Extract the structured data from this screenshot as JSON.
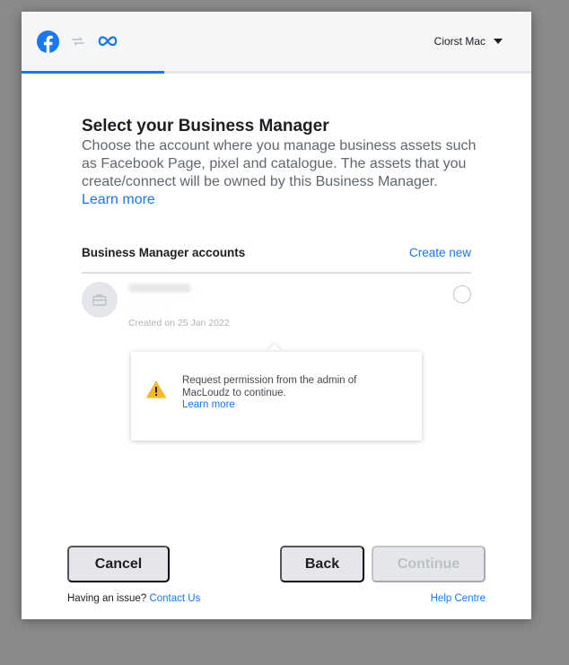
{
  "header": {
    "user_name": "Ciorst Mac",
    "progress_percent": 28
  },
  "main": {
    "title": "Select your Business Manager",
    "description": "Choose the account where you manage business assets such as Facebook Page, pixel and catalogue. The assets that you create/connect will be owned by this Business Manager.",
    "learn_more": "Learn more"
  },
  "accounts": {
    "section_label": "Business Manager accounts",
    "create_new": "Create new",
    "items": [
      {
        "dots": ". . . .",
        "created": "Created on 25 Jan 2022"
      }
    ]
  },
  "tooltip": {
    "message": "Request permission from the admin of MacLoudz to continue.",
    "learn_more": "Learn more"
  },
  "footer": {
    "cancel_label": "Cancel",
    "back_label": "Back",
    "continue_label": "Continue",
    "issue_text": "Having an issue?",
    "contact_us": "Contact Us",
    "help_centre": "Help Centre"
  },
  "colors": {
    "brand_blue": "#1877f2",
    "warning_yellow": "#f7b928"
  },
  "icons": {
    "brand": "facebook-icon",
    "connector": "link-icon",
    "meta": "meta-infinity-icon",
    "dropdown": "caret-down-icon",
    "account": "briefcase-icon",
    "warning": "warning-triangle-icon"
  }
}
